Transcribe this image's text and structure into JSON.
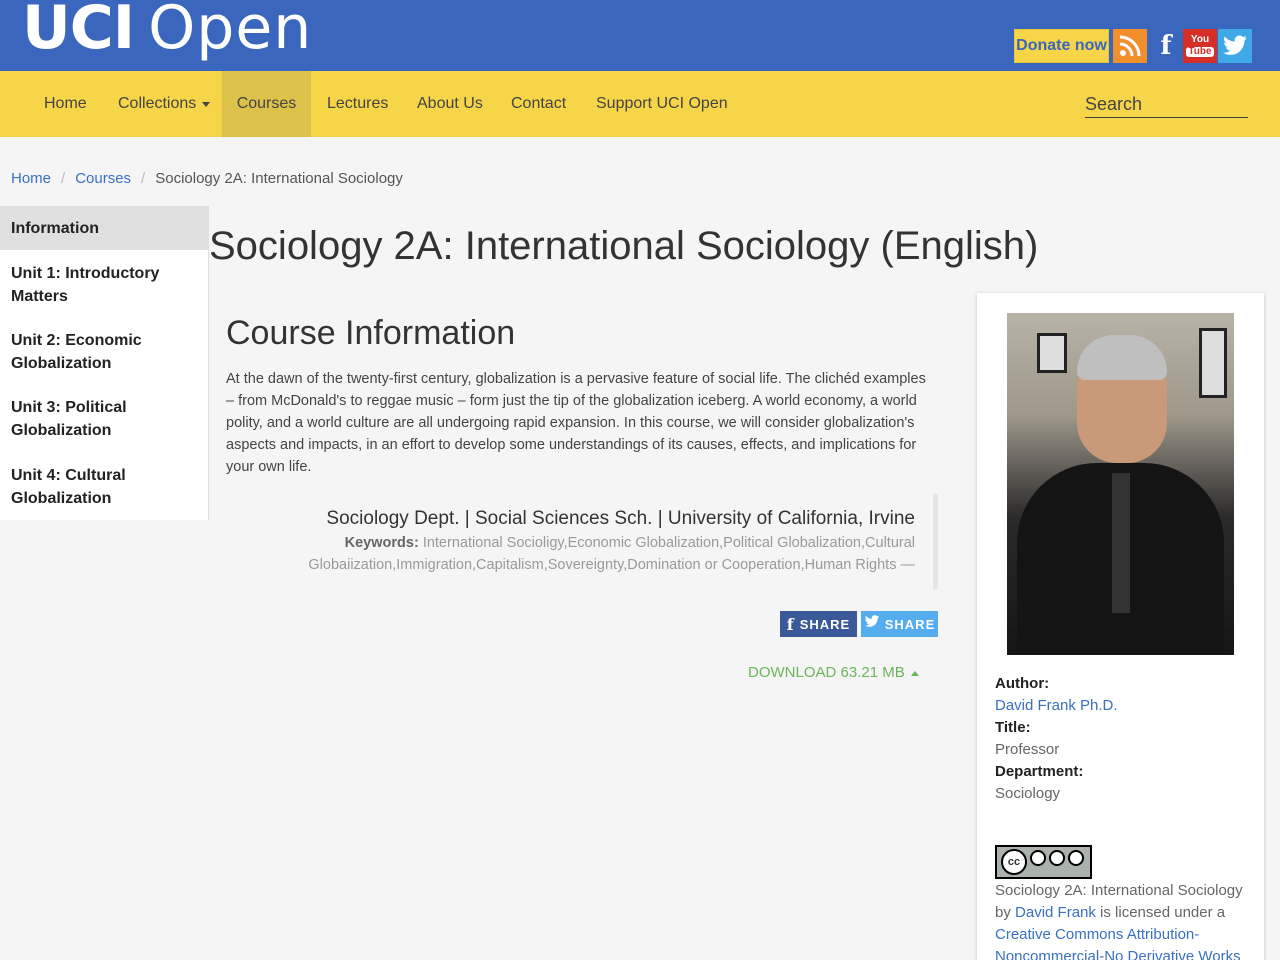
{
  "header": {
    "logo_uci": "UCI",
    "logo_open": "Open",
    "donate_label": "Donate now",
    "social": [
      {
        "name": "rss-icon",
        "glyph": "◗"
      },
      {
        "name": "facebook-icon",
        "glyph": "f"
      },
      {
        "name": "youtube-icon",
        "glyph": "You Tube"
      },
      {
        "name": "twitter-icon",
        "glyph": "🐦"
      }
    ]
  },
  "nav": {
    "items": [
      "Home",
      "Collections",
      "Courses",
      "Lectures",
      "About Us",
      "Contact",
      "Support UCI Open"
    ],
    "active": "Courses",
    "search_placeholder": "Search"
  },
  "breadcrumb": {
    "items": [
      "Home",
      "Courses"
    ],
    "current": "Sociology 2A: International Sociology"
  },
  "sidebar": {
    "items": [
      "Information",
      "Unit 1: Introductory Matters",
      "Unit 2: Economic Globalization",
      "Unit 3: Political Globalization",
      "Unit 4: Cultural Globalization"
    ]
  },
  "main": {
    "title": "Sociology 2A: International Sociology (English)",
    "section_title": "Course Information",
    "description": "At the dawn of the twenty-first century, globalization is a pervasive feature of social life. The clichéd examples – from McDonald's to reggae music – form just the tip of the globalization iceberg. A world economy, a world polity, and a world culture are all undergoing rapid expansion. In this course, we will consider globalization's aspects and impacts, in an effort to develop some understandings of its causes, effects, and implications for your own life.",
    "dept_line": "Sociology Dept. | Social Sciences Sch. | University of California, Irvine",
    "keywords_label": "Keywords:",
    "keywords": "International Socioligy,Economic Globalization,Political Globalization,Cultural Globaiization,Immigration,Capitalism,Sovereignty,Domination or Cooperation,Human Rights —",
    "share_fb": "SHARE",
    "share_tw": "SHARE",
    "download": "DOWNLOAD 63.21 MB"
  },
  "author": {
    "author_label": "Author:",
    "author_name": "David Frank Ph.D.",
    "title_label": "Title:",
    "title_value": "Professor",
    "dept_label": "Department:",
    "dept_value": "Sociology",
    "cc_text": "cc",
    "license_prefix": "Sociology 2A: International Sociology by",
    "license_author": "David Frank",
    "license_mid": "is licensed under a",
    "license_link": "Creative Commons Attribution-Noncommercial-No Derivative Works"
  },
  "colors": {
    "header_blue": "#3a66bd",
    "nav_yellow": "#f7d548",
    "link_blue": "#3a70c2",
    "download_green": "#6ab65a"
  }
}
